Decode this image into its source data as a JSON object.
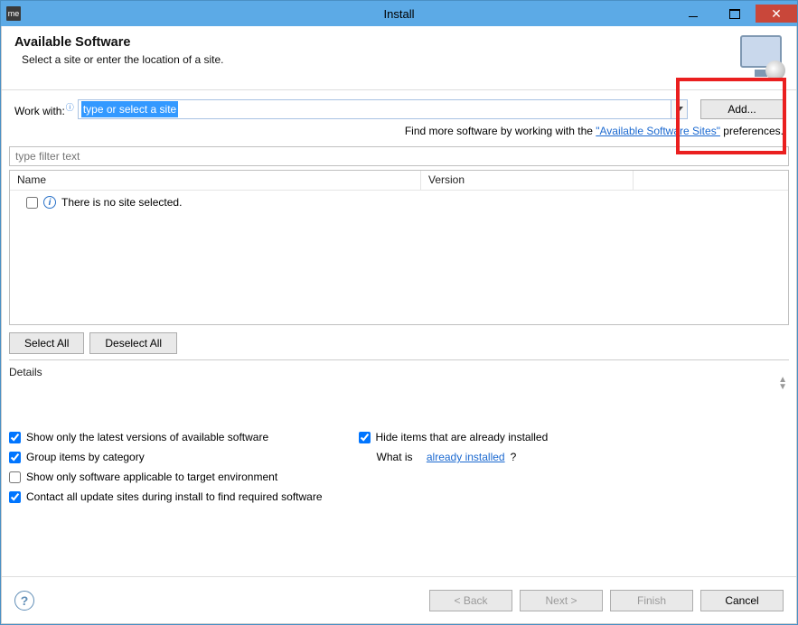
{
  "titlebar": {
    "icon_text": "me",
    "title": "Install"
  },
  "banner": {
    "title": "Available Software",
    "subtitle": "Select a site or enter the location of a site."
  },
  "work": {
    "label": "Work with:",
    "placeholder_selected": "type or select a site",
    "add_button": "Add..."
  },
  "find_more": {
    "prefix": "Find more software by working with the ",
    "link": "\"Available Software Sites\"",
    "suffix": " preferences."
  },
  "filter": {
    "placeholder": "type filter text"
  },
  "columns": {
    "name": "Name",
    "version": "Version"
  },
  "tree": {
    "empty_msg": "There is no site selected."
  },
  "selection": {
    "select_all": "Select All",
    "deselect_all": "Deselect All"
  },
  "details": {
    "label": "Details"
  },
  "options": {
    "latest_versions": {
      "label": "Show only the latest versions of available software",
      "checked": true
    },
    "group_category": {
      "label": "Group items by category",
      "checked": true
    },
    "target_env": {
      "label": "Show only software applicable to target environment",
      "checked": false
    },
    "contact_all": {
      "label": "Contact all update sites during install to find required software",
      "checked": true
    },
    "hide_installed": {
      "label": "Hide items that are already installed",
      "checked": true
    },
    "what_is_prefix": "What is ",
    "what_is_link": "already installed",
    "what_is_suffix": "?"
  },
  "footer": {
    "back": "< Back",
    "next": "Next >",
    "finish": "Finish",
    "cancel": "Cancel"
  }
}
